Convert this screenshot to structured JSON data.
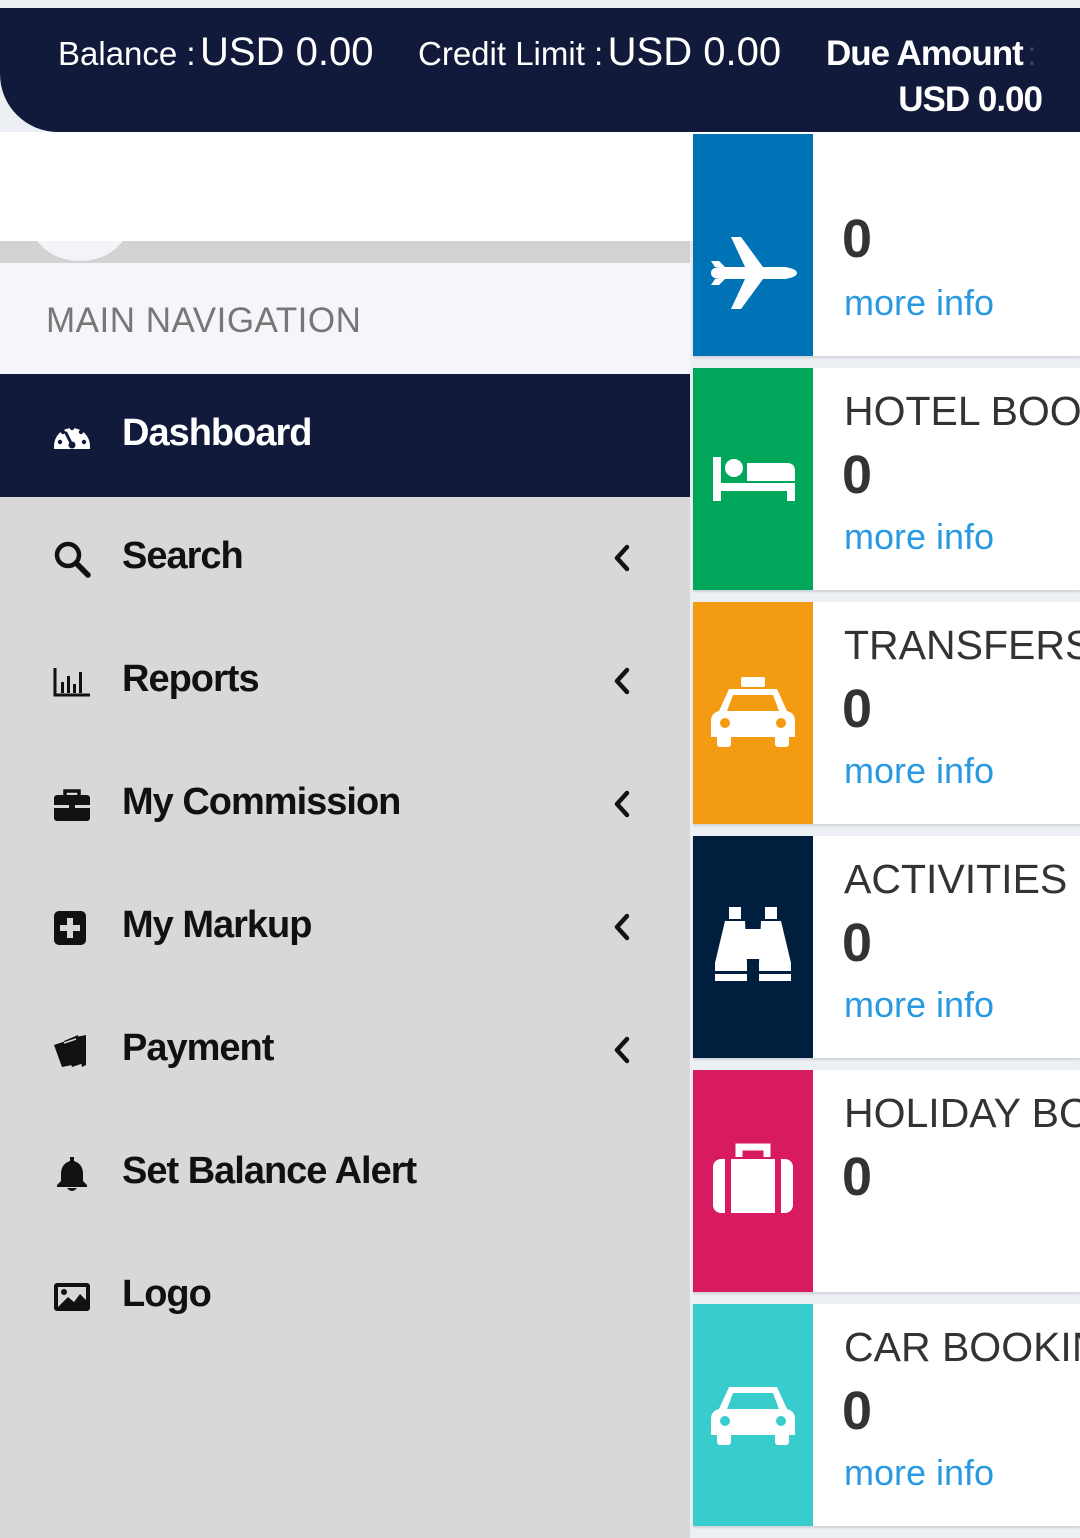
{
  "balance_bar": {
    "balance_label": "Balance :",
    "balance_value": "USD 0.00",
    "credit_label": "Credit Limit :",
    "credit_value": "USD 0.00",
    "due_label": "Due Amount",
    "due_colon": ":",
    "due_value": "USD 0.00"
  },
  "user": {
    "name": "-"
  },
  "sidebar": {
    "header": "MAIN NAVIGATION",
    "items": [
      {
        "label": "Dashboard",
        "icon": "tachometer-icon",
        "active": true,
        "has_submenu": false
      },
      {
        "label": "Search",
        "icon": "search-icon",
        "has_submenu": true
      },
      {
        "label": "Reports",
        "icon": "bar-chart-icon",
        "has_submenu": true
      },
      {
        "label": "My Commission",
        "icon": "briefcase-icon",
        "has_submenu": true
      },
      {
        "label": "My Markup",
        "icon": "plus-square-icon",
        "has_submenu": true
      },
      {
        "label": "Payment",
        "icon": "wallet-icon",
        "has_submenu": true
      },
      {
        "label": "Set Balance Alert",
        "icon": "bell-icon",
        "has_submenu": false
      },
      {
        "label": "Logo",
        "icon": "image-icon",
        "has_submenu": false
      }
    ]
  },
  "info_boxes": [
    {
      "title": "",
      "count": "0",
      "link": "more info",
      "color": "#0073b7",
      "icon": "plane-icon"
    },
    {
      "title": "HOTEL BOO",
      "count": "0",
      "link": "more info",
      "color": "#00a65a",
      "icon": "bed-icon"
    },
    {
      "title": "TRANSFERS",
      "count": "0",
      "link": "more info",
      "color": "#f39c12",
      "icon": "taxi-icon"
    },
    {
      "title": "ACTIVITIES",
      "count": "0",
      "link": "more info",
      "color": "#001f3f",
      "icon": "binoculars-icon"
    },
    {
      "title": "HOLIDAY BO",
      "count": "0",
      "link": "",
      "color": "#d81b60",
      "icon": "suitcase-icon"
    },
    {
      "title": "CAR BOOKIN",
      "count": "0",
      "link": "more info",
      "color": "#39cccc",
      "icon": "car-icon"
    }
  ],
  "colors": {
    "navy": "#111a3a",
    "link": "#2a9ae0",
    "sidebar_bg": "#d8d8d8"
  }
}
